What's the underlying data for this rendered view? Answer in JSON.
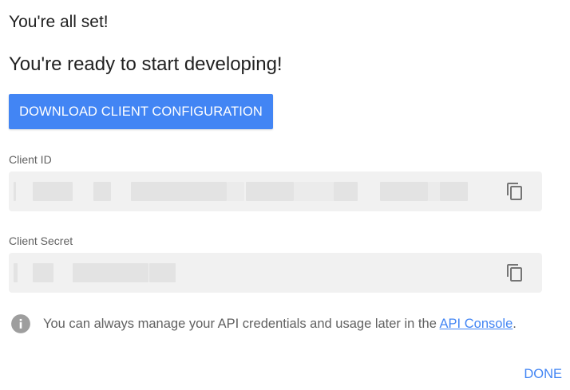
{
  "dialog": {
    "title": "You're all set!",
    "subtitle": "You're ready to start developing!",
    "download_button_label": "DOWNLOAD CLIENT CONFIGURATION",
    "client_id": {
      "label": "Client ID",
      "copy_icon": "copy-icon"
    },
    "client_secret": {
      "label": "Client Secret",
      "copy_icon": "copy-icon"
    },
    "info": {
      "icon": "info-icon",
      "text_before_link": "You can always manage your API credentials and usage later in the ",
      "link_text": "API Console",
      "text_after_link": "."
    },
    "done_button_label": "DONE"
  },
  "colors": {
    "accent": "#4285f4",
    "field_background": "#f1f1f1",
    "muted_text": "#616161",
    "primary_text": "#212121"
  }
}
